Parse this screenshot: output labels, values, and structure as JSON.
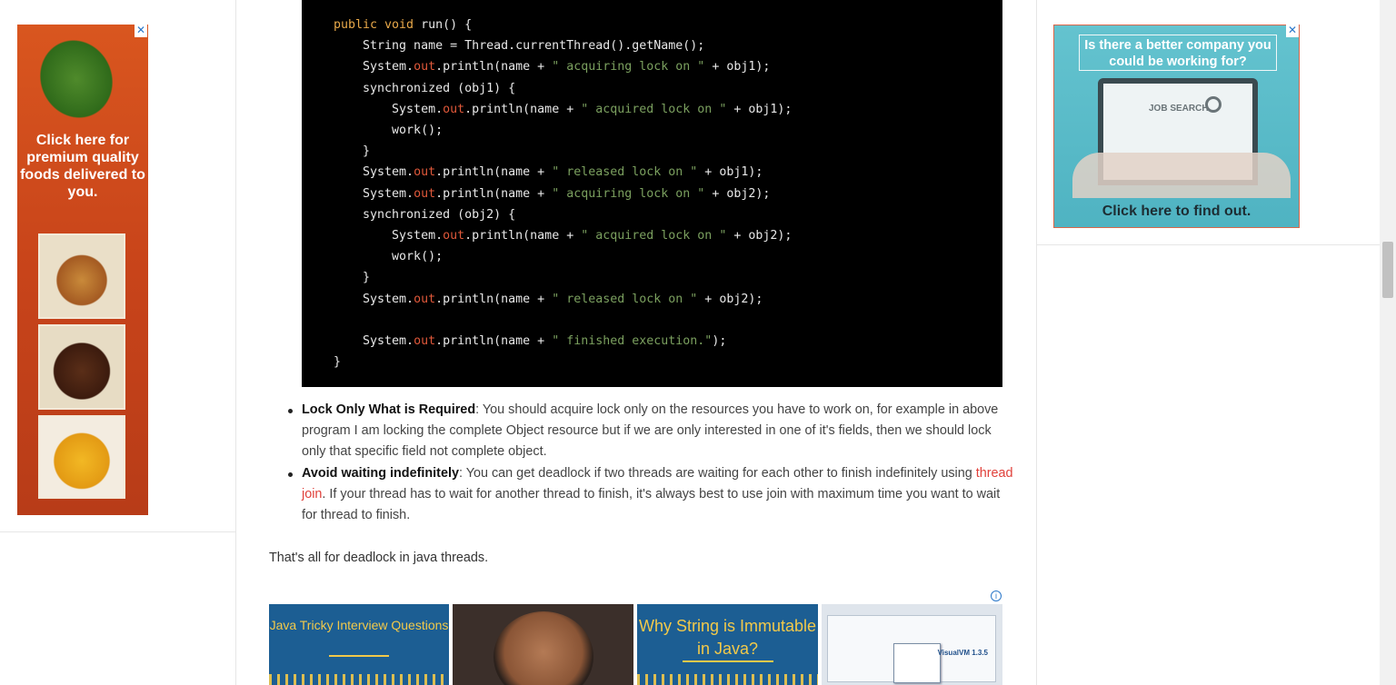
{
  "ads": {
    "left": {
      "text": "Click here for premium quality foods delivered to you.",
      "close_label": "✕"
    },
    "right": {
      "headline": "Is there a better company you could be working for?",
      "screen_text": "JOB SEARCH",
      "cta": "Click here to find out.",
      "close_label": "✕"
    }
  },
  "code": {
    "lines": [
      [
        [
          "kw",
          "public void "
        ],
        [
          "txt",
          "run() {"
        ]
      ],
      [
        [
          "txt",
          "    String name = Thread.currentThread().getName();"
        ]
      ],
      [
        [
          "txt",
          "    System."
        ],
        [
          "fld",
          "out"
        ],
        [
          "txt",
          ".println(name + "
        ],
        [
          "str",
          "\" acquiring lock on \""
        ],
        [
          "txt",
          " + obj1);"
        ]
      ],
      [
        [
          "txt",
          "    synchronized (obj1) {"
        ]
      ],
      [
        [
          "txt",
          "        System."
        ],
        [
          "fld",
          "out"
        ],
        [
          "txt",
          ".println(name + "
        ],
        [
          "str",
          "\" acquired lock on \""
        ],
        [
          "txt",
          " + obj1);"
        ]
      ],
      [
        [
          "txt",
          "        work();"
        ]
      ],
      [
        [
          "txt",
          "    }"
        ]
      ],
      [
        [
          "txt",
          "    System."
        ],
        [
          "fld",
          "out"
        ],
        [
          "txt",
          ".println(name + "
        ],
        [
          "str",
          "\" released lock on \""
        ],
        [
          "txt",
          " + obj1);"
        ]
      ],
      [
        [
          "txt",
          "    System."
        ],
        [
          "fld",
          "out"
        ],
        [
          "txt",
          ".println(name + "
        ],
        [
          "str",
          "\" acquiring lock on \""
        ],
        [
          "txt",
          " + obj2);"
        ]
      ],
      [
        [
          "txt",
          "    synchronized (obj2) {"
        ]
      ],
      [
        [
          "txt",
          "        System."
        ],
        [
          "fld",
          "out"
        ],
        [
          "txt",
          ".println(name + "
        ],
        [
          "str",
          "\" acquired lock on \""
        ],
        [
          "txt",
          " + obj2);"
        ]
      ],
      [
        [
          "txt",
          "        work();"
        ]
      ],
      [
        [
          "txt",
          "    }"
        ]
      ],
      [
        [
          "txt",
          "    System."
        ],
        [
          "fld",
          "out"
        ],
        [
          "txt",
          ".println(name + "
        ],
        [
          "str",
          "\" released lock on \""
        ],
        [
          "txt",
          " + obj2);"
        ]
      ],
      [
        [
          "txt",
          ""
        ]
      ],
      [
        [
          "txt",
          "    System."
        ],
        [
          "fld",
          "out"
        ],
        [
          "txt",
          ".println(name + "
        ],
        [
          "str",
          "\" finished execution.\""
        ],
        [
          "txt",
          ");"
        ]
      ],
      [
        [
          "txt",
          "}"
        ]
      ]
    ]
  },
  "tips": [
    {
      "title": "Lock Only What is Required",
      "text": ": You should acquire lock only on the resources you have to work on, for example in above program I am locking the complete Object resource but if we are only interested in one of it's fields, then we should lock only that specific field not complete object."
    },
    {
      "title": "Avoid waiting indefinitely",
      "text_before": ": You can get deadlock if two threads are waiting for each other to finish indefinitely using ",
      "link": "thread join",
      "text_after": ". If your thread has to wait for another thread to finish, it's always best to use join with maximum time you want to wait for thread to finish."
    }
  ],
  "closing": "That's all for deadlock in java threads.",
  "related": {
    "adchoices_label": "i",
    "tiles": [
      {
        "title": "Java Tricky Interview Questions"
      },
      {
        "title": ""
      },
      {
        "title": "Why String is Immutable in Java?"
      },
      {
        "title": "VisualVM 1.3.5"
      }
    ]
  },
  "colors": {
    "keyword": "#e9a94a",
    "string": "#7ba05f",
    "field": "#e0583a",
    "link": "#e0403a",
    "tile_blue": "#1c5e93",
    "tile_gold": "#f2c94a"
  }
}
